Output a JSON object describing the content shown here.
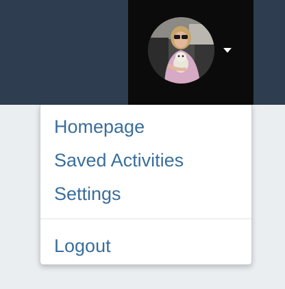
{
  "header": {
    "avatar_icon": "user-avatar-photo",
    "caret_icon": "caret-down-icon"
  },
  "user_menu": {
    "items": [
      {
        "label": "Homepage"
      },
      {
        "label": "Saved Activities"
      },
      {
        "label": "Settings"
      }
    ],
    "logout_label": "Logout"
  },
  "colors": {
    "header_bg": "#2e3d4f",
    "trigger_bg": "#0b0b0b",
    "link": "#3a6e9b",
    "page_bg": "#ebeef0"
  }
}
